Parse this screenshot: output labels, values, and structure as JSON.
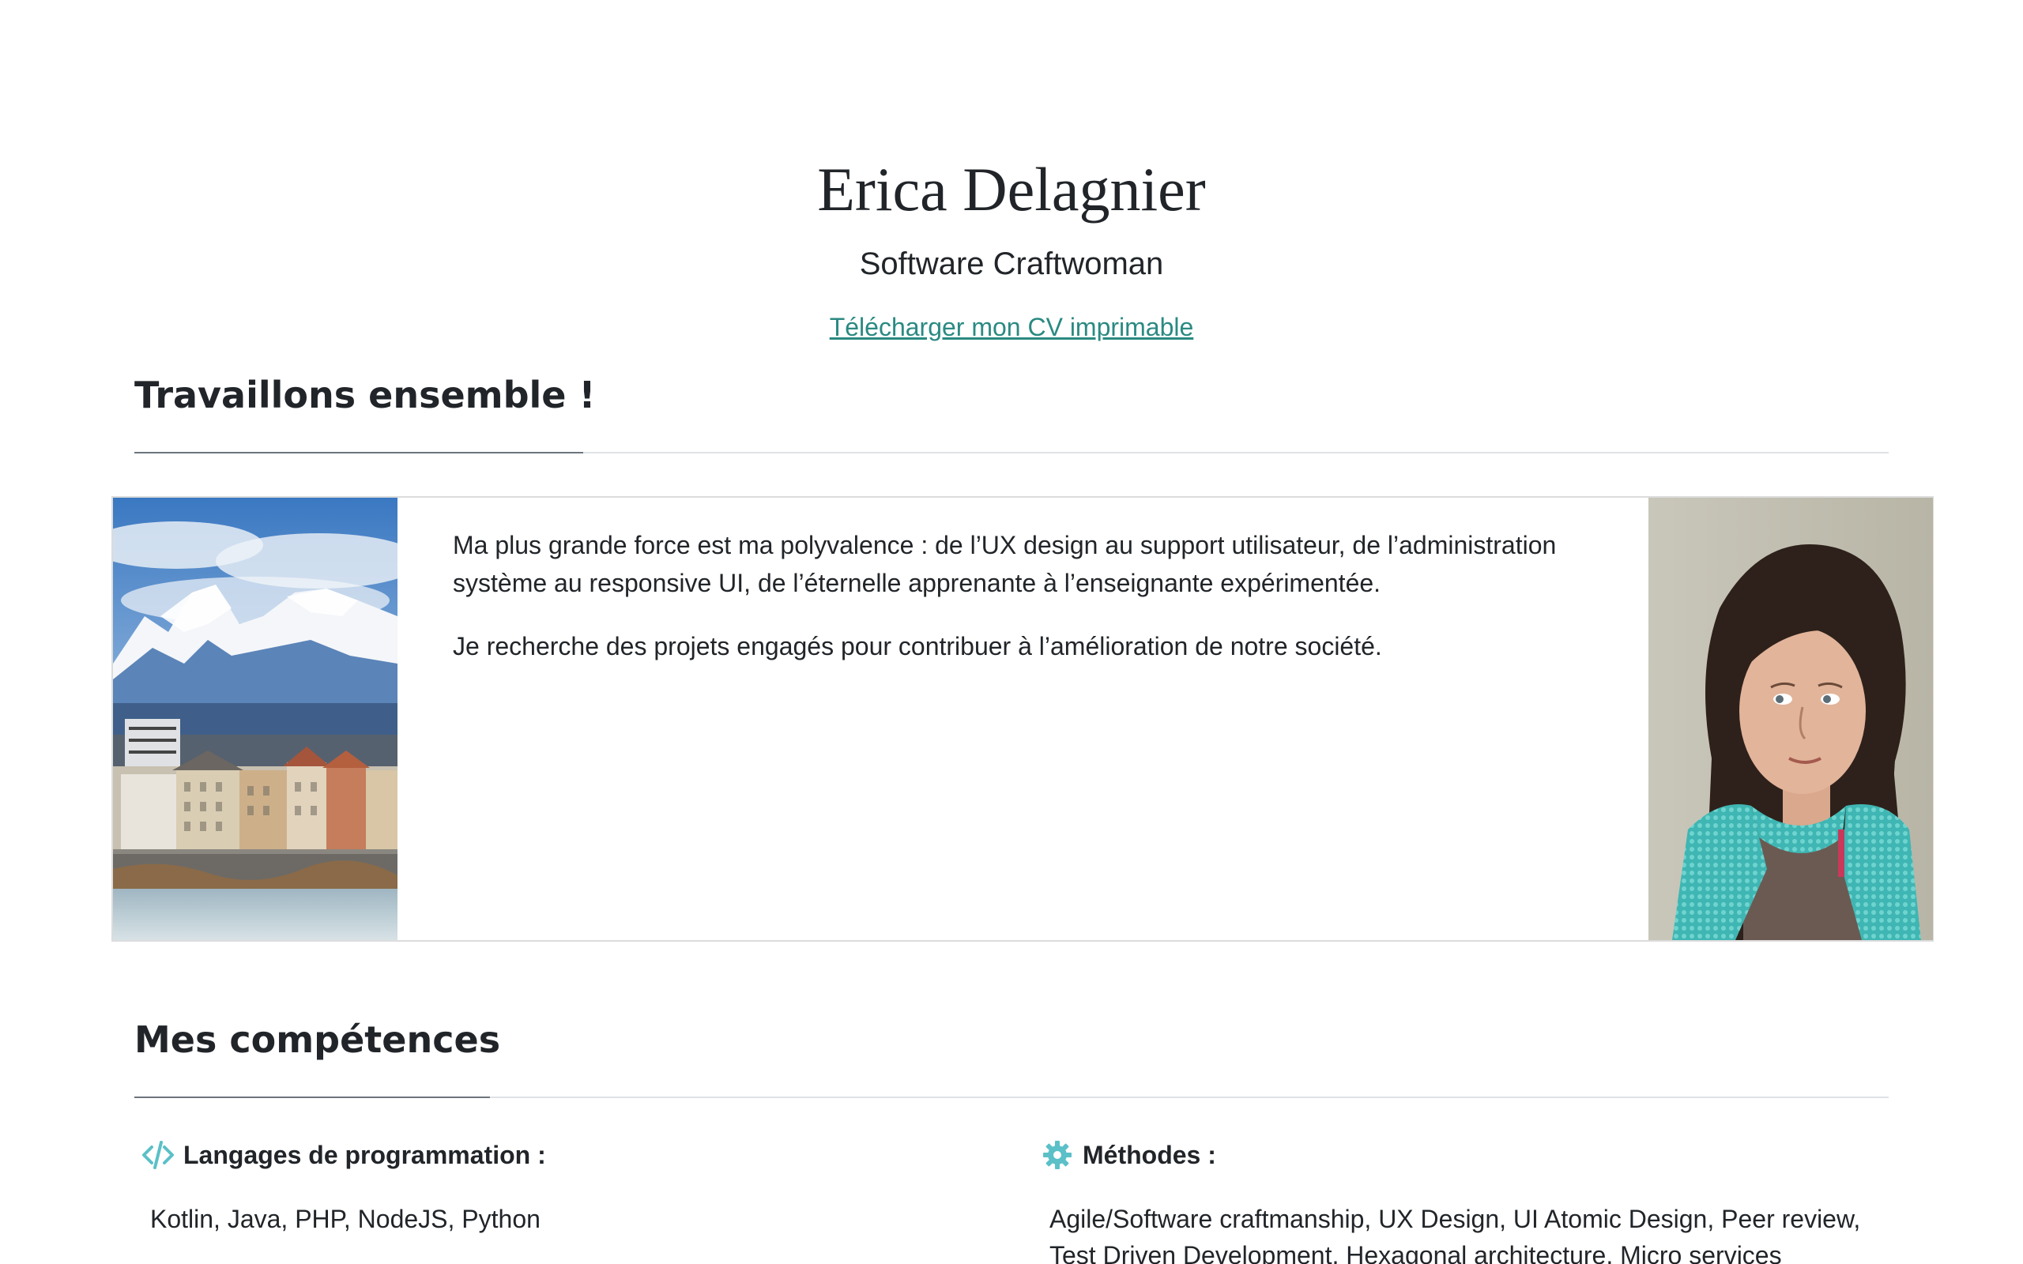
{
  "header": {
    "name": "Erica Delagnier",
    "subtitle": "Software Craftwoman",
    "cv_link": "Télécharger mon CV imprimable"
  },
  "intro": {
    "title": "Travaillons ensemble !",
    "paragraphs": [
      "Ma plus grande force est ma polyvalence : de l’UX design au support utilisateur, de l’administration système au responsive UI, de l’éternelle apprenante à l’enseignante expérimentée.",
      "Je recherche des projets engagés pour contribuer à l’amélioration de notre société."
    ]
  },
  "skills": {
    "title": "Mes compétences",
    "items": [
      {
        "icon": "code-icon",
        "label": "Langages de programmation :",
        "value": "Kotlin, Java, PHP, NodeJS, Python"
      },
      {
        "icon": "gear-icon",
        "label": "Méthodes :",
        "value": "Agile/Software craftmanship, UX Design, UI Atomic Design, Peer review, Test Driven Development, Hexagonal architecture, Micro services"
      }
    ]
  },
  "colors": {
    "accent": "#2a8a82",
    "icon": "#5bc0c8",
    "text": "#212529",
    "rule": "#dee2e6"
  }
}
